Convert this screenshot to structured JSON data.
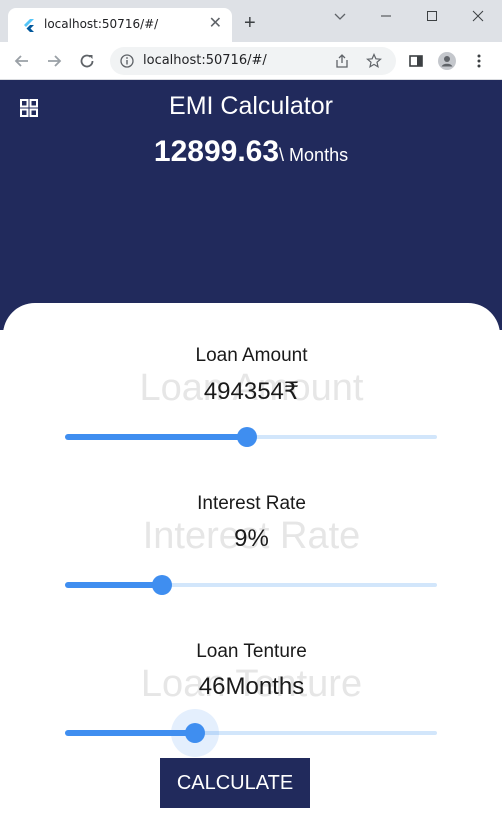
{
  "browser": {
    "tab_title": "localhost:50716/#/",
    "url": "localhost:50716/#/",
    "new_tab_symbol": "+",
    "close_symbol": "✕"
  },
  "app": {
    "title": "EMI Calculator",
    "emi_value": "12899.63",
    "emi_unit": "\\ Months",
    "colors": {
      "primary": "#212a5c",
      "accent": "#3f8ef0",
      "track": "#d2e6fb",
      "ghost_text": "#e6e6e6"
    }
  },
  "sliders": [
    {
      "label": "Loan Amount",
      "ghost": "Loan Amount",
      "value_text": "494354₹",
      "position": 0.49,
      "focused": false
    },
    {
      "label": "Interest Rate",
      "ghost": "Interest Rate",
      "value_text": "9%",
      "position": 0.26,
      "focused": false
    },
    {
      "label": "Loan Tenture",
      "ghost": "Loan Tenture",
      "value_text": "46Months",
      "position": 0.35,
      "focused": true
    }
  ],
  "calculate_label": "CALCULATE"
}
